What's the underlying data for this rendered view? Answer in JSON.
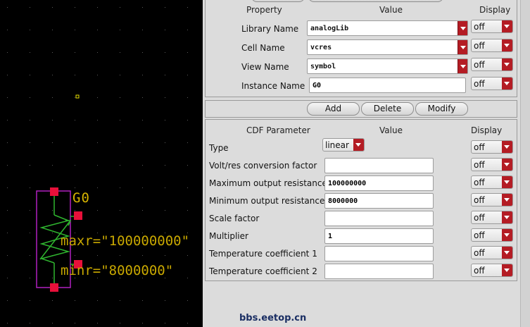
{
  "schematic": {
    "instance_name": "G0",
    "params": [
      "maxr=\"100000000\"",
      "minr=\"8000000\""
    ]
  },
  "instance_form": {
    "headers": {
      "property": "Property",
      "value": "Value",
      "display": "Display"
    },
    "rows": [
      {
        "label": "Library Name",
        "value": "analogLib",
        "display": "off"
      },
      {
        "label": "Cell Name",
        "value": "vcres",
        "display": "off"
      },
      {
        "label": "View Name",
        "value": "symbol",
        "display": "off"
      },
      {
        "label": "Instance Name",
        "value": "G0",
        "display": "off"
      }
    ]
  },
  "actions": {
    "add": "Add",
    "delete": "Delete",
    "modify": "Modify"
  },
  "cdf": {
    "headers": {
      "param": "CDF Parameter",
      "value": "Value",
      "display": "Display"
    },
    "rows": [
      {
        "label": "Type",
        "value": "linear",
        "display": "off"
      },
      {
        "label": "Volt/res conversion factor",
        "value": "",
        "display": "off"
      },
      {
        "label": "Maximum output resistance",
        "value": "100000000",
        "display": "off"
      },
      {
        "label": "Minimum output resistance",
        "value": "8000000",
        "display": "off"
      },
      {
        "label": "Scale factor",
        "value": "",
        "display": "off"
      },
      {
        "label": "Multiplier",
        "value": "1",
        "display": "off"
      },
      {
        "label": "Temperature coefficient 1",
        "value": "",
        "display": "off"
      },
      {
        "label": "Temperature coefficient 2",
        "value": "",
        "display": "off"
      }
    ]
  },
  "watermark": "bbs.eetop.cn",
  "colors": {
    "pin": "#e8103a",
    "symbol_outline": "#b020c0",
    "wire": "#2fb52f",
    "label": "#d7b400",
    "arrow": "#b41c24"
  }
}
